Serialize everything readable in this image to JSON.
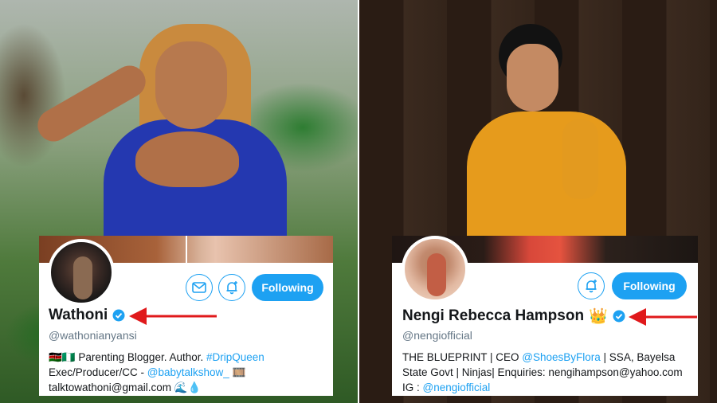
{
  "colors": {
    "twitter_blue": "#1da1f2",
    "handle_gray": "#657786",
    "text_dark": "#14171a",
    "arrow_red": "#e0191b"
  },
  "left_profile": {
    "name": "Wathoni",
    "handle": "@wathonianyansi",
    "follow_label": "Following",
    "bio": {
      "line1_flags": "🇰🇪🇳🇬",
      "line1_text": " Parenting Blogger. Author. ",
      "line1_hashtag": "#DripQueen",
      "line2_text": "Exec/Producer/CC - ",
      "line2_mention": "@babytalkshow_",
      "line2_emoji": " 🎞️",
      "line3_text": "talktowathoni@gmail.com ",
      "line3_emoji": "🌊💧"
    },
    "icons": [
      "mail-icon",
      "bell-plus-icon",
      "verified-badge-icon"
    ]
  },
  "right_profile": {
    "name": "Nengi Rebecca Hampson",
    "crown": "👑",
    "handle": "@nengiofficial",
    "follow_label": "Following",
    "bio": {
      "line1_text": "THE BLUEPRINT | CEO ",
      "line1_mention": "@ShoesByFlora",
      "line1_tail": " | SSA, Bayelsa",
      "line2_text": "State Govt | Ninjas| Enquiries: nengihampson@yahoo.com",
      "line3_text": "IG : ",
      "line3_mention": "@nengiofficial"
    },
    "icons": [
      "bell-plus-icon",
      "verified-badge-icon"
    ]
  }
}
